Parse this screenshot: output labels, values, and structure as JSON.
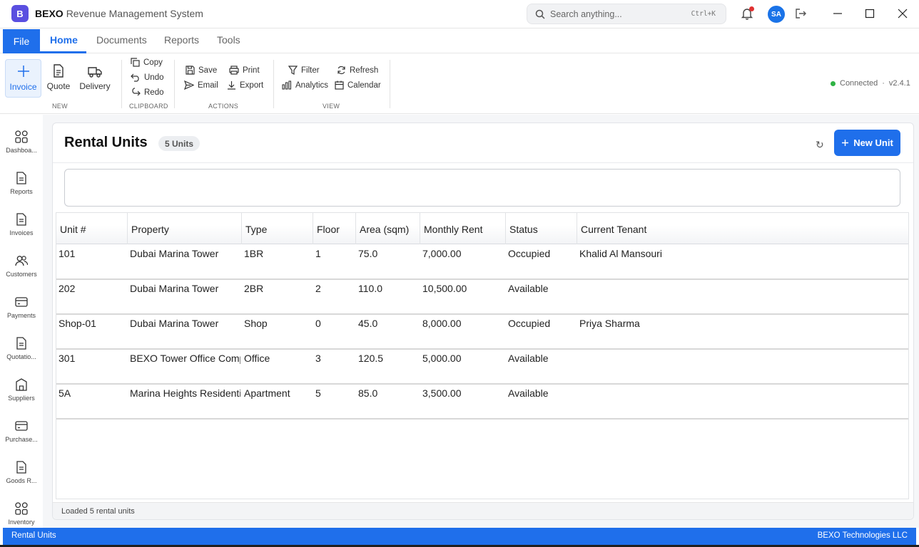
{
  "window": {
    "logo_letter": "B",
    "brand": "BEXO",
    "title": "Revenue Management System",
    "search_placeholder": "Search anything...",
    "search_shortcut": "Ctrl+K",
    "user_initials": "SA"
  },
  "menu": {
    "file": "File",
    "tabs": [
      "Home",
      "Documents",
      "Reports",
      "Tools"
    ],
    "active_tab": "Home"
  },
  "ribbon": {
    "new": {
      "label": "NEW",
      "items": [
        "Invoice",
        "Quote",
        "Delivery"
      ]
    },
    "clipboard": {
      "label": "CLIPBOARD",
      "items": [
        "Copy",
        "Undo",
        "Redo"
      ]
    },
    "actions": {
      "label": "ACTIONS",
      "items": [
        "Save",
        "Print",
        "Email",
        "Export"
      ]
    },
    "view": {
      "label": "VIEW",
      "items": [
        "Filter",
        "Refresh",
        "Analytics",
        "Calendar"
      ]
    },
    "status": {
      "connection": "Connected",
      "separator": "·",
      "version": "v2.4.1",
      "color": "#2fb344"
    }
  },
  "sidebar": {
    "items": [
      {
        "label": "Dashboa...",
        "icon": "dashboard-icon"
      },
      {
        "label": "Reports",
        "icon": "document-icon"
      },
      {
        "label": "Invoices",
        "icon": "document-icon"
      },
      {
        "label": "Customers",
        "icon": "users-icon"
      },
      {
        "label": "Payments",
        "icon": "card-icon"
      },
      {
        "label": "Quotatio...",
        "icon": "document-icon"
      },
      {
        "label": "Suppliers",
        "icon": "building-icon"
      },
      {
        "label": "Purchase...",
        "icon": "card-icon"
      },
      {
        "label": "Goods R...",
        "icon": "document-icon"
      },
      {
        "label": "Inventory",
        "icon": "dashboard-icon"
      }
    ]
  },
  "main": {
    "title": "Rental Units",
    "count_badge": "5 Units",
    "new_button": "New Unit",
    "refresh_glyph": "↻",
    "table": {
      "columns": [
        "Unit #",
        "Property",
        "Type",
        "Floor",
        "Area (sqm)",
        "Monthly Rent",
        "Status",
        "Current Tenant"
      ],
      "rows": [
        [
          "101",
          "Dubai Marina Tower",
          "1BR",
          "1",
          "75.0",
          "7,000.00",
          "Occupied",
          "Khalid Al Mansouri"
        ],
        [
          "202",
          "Dubai Marina Tower",
          "2BR",
          "2",
          "110.0",
          "10,500.00",
          "Available",
          ""
        ],
        [
          "Shop-01",
          "Dubai Marina Tower",
          "Shop",
          "0",
          "45.0",
          "8,000.00",
          "Occupied",
          "Priya Sharma"
        ],
        [
          "301",
          "BEXO Tower Office Comp",
          "Office",
          "3",
          "120.5",
          "5,000.00",
          "Available",
          ""
        ],
        [
          "5A",
          "Marina Heights Residenti",
          "Apartment",
          "5",
          "85.0",
          "3,500.00",
          "Available",
          ""
        ]
      ]
    },
    "footer_status": "Loaded 5 rental units"
  },
  "statusbar": {
    "left": "Rental Units",
    "right": "BEXO Technologies LLC"
  },
  "colors": {
    "accent": "#1f6feb",
    "logo": "#5a4fe0",
    "notification": "#e03131"
  }
}
